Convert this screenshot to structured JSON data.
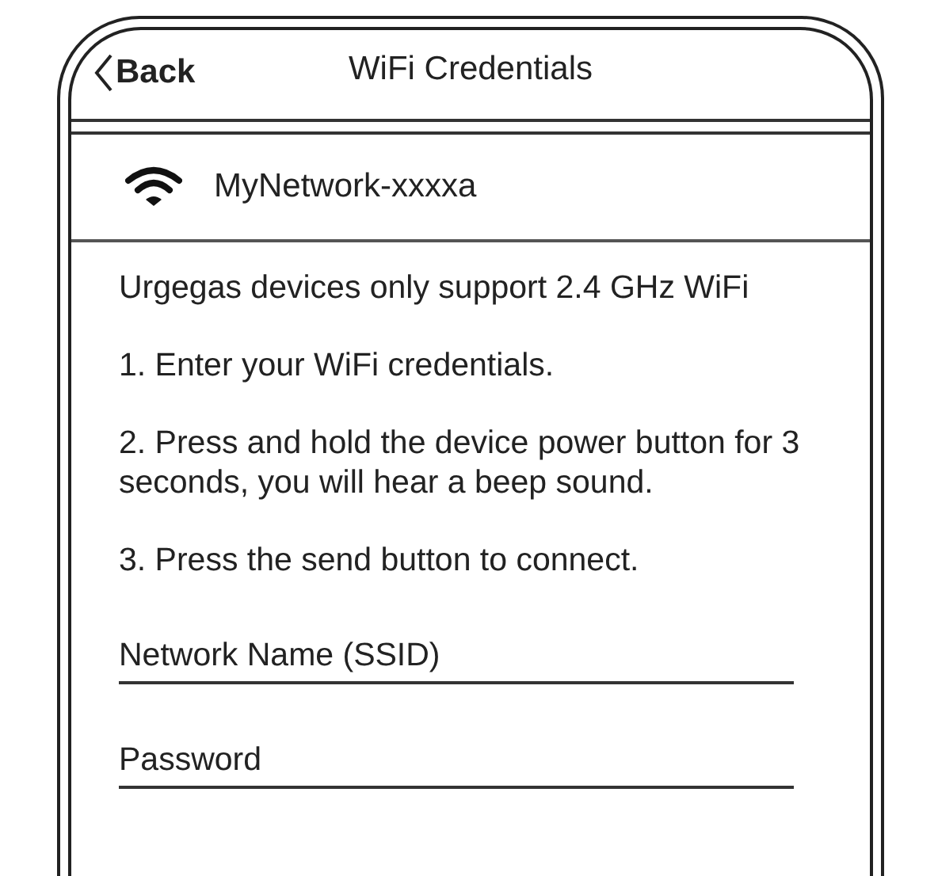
{
  "header": {
    "back": "Back",
    "title": "WiFi Credentials"
  },
  "network": {
    "name": "MyNetwork-xxxxa"
  },
  "instructions": [
    "Urgegas devices only support 2.4 GHz WiFi",
    "1. Enter your WiFi credentials.",
    "2. Press and hold the device power button for 3 seconds, you will hear a beep sound.",
    "3. Press the send button to connect."
  ],
  "fields": [
    {
      "placeholder": "Network Name (SSID)"
    },
    {
      "placeholder": "Password"
    }
  ]
}
